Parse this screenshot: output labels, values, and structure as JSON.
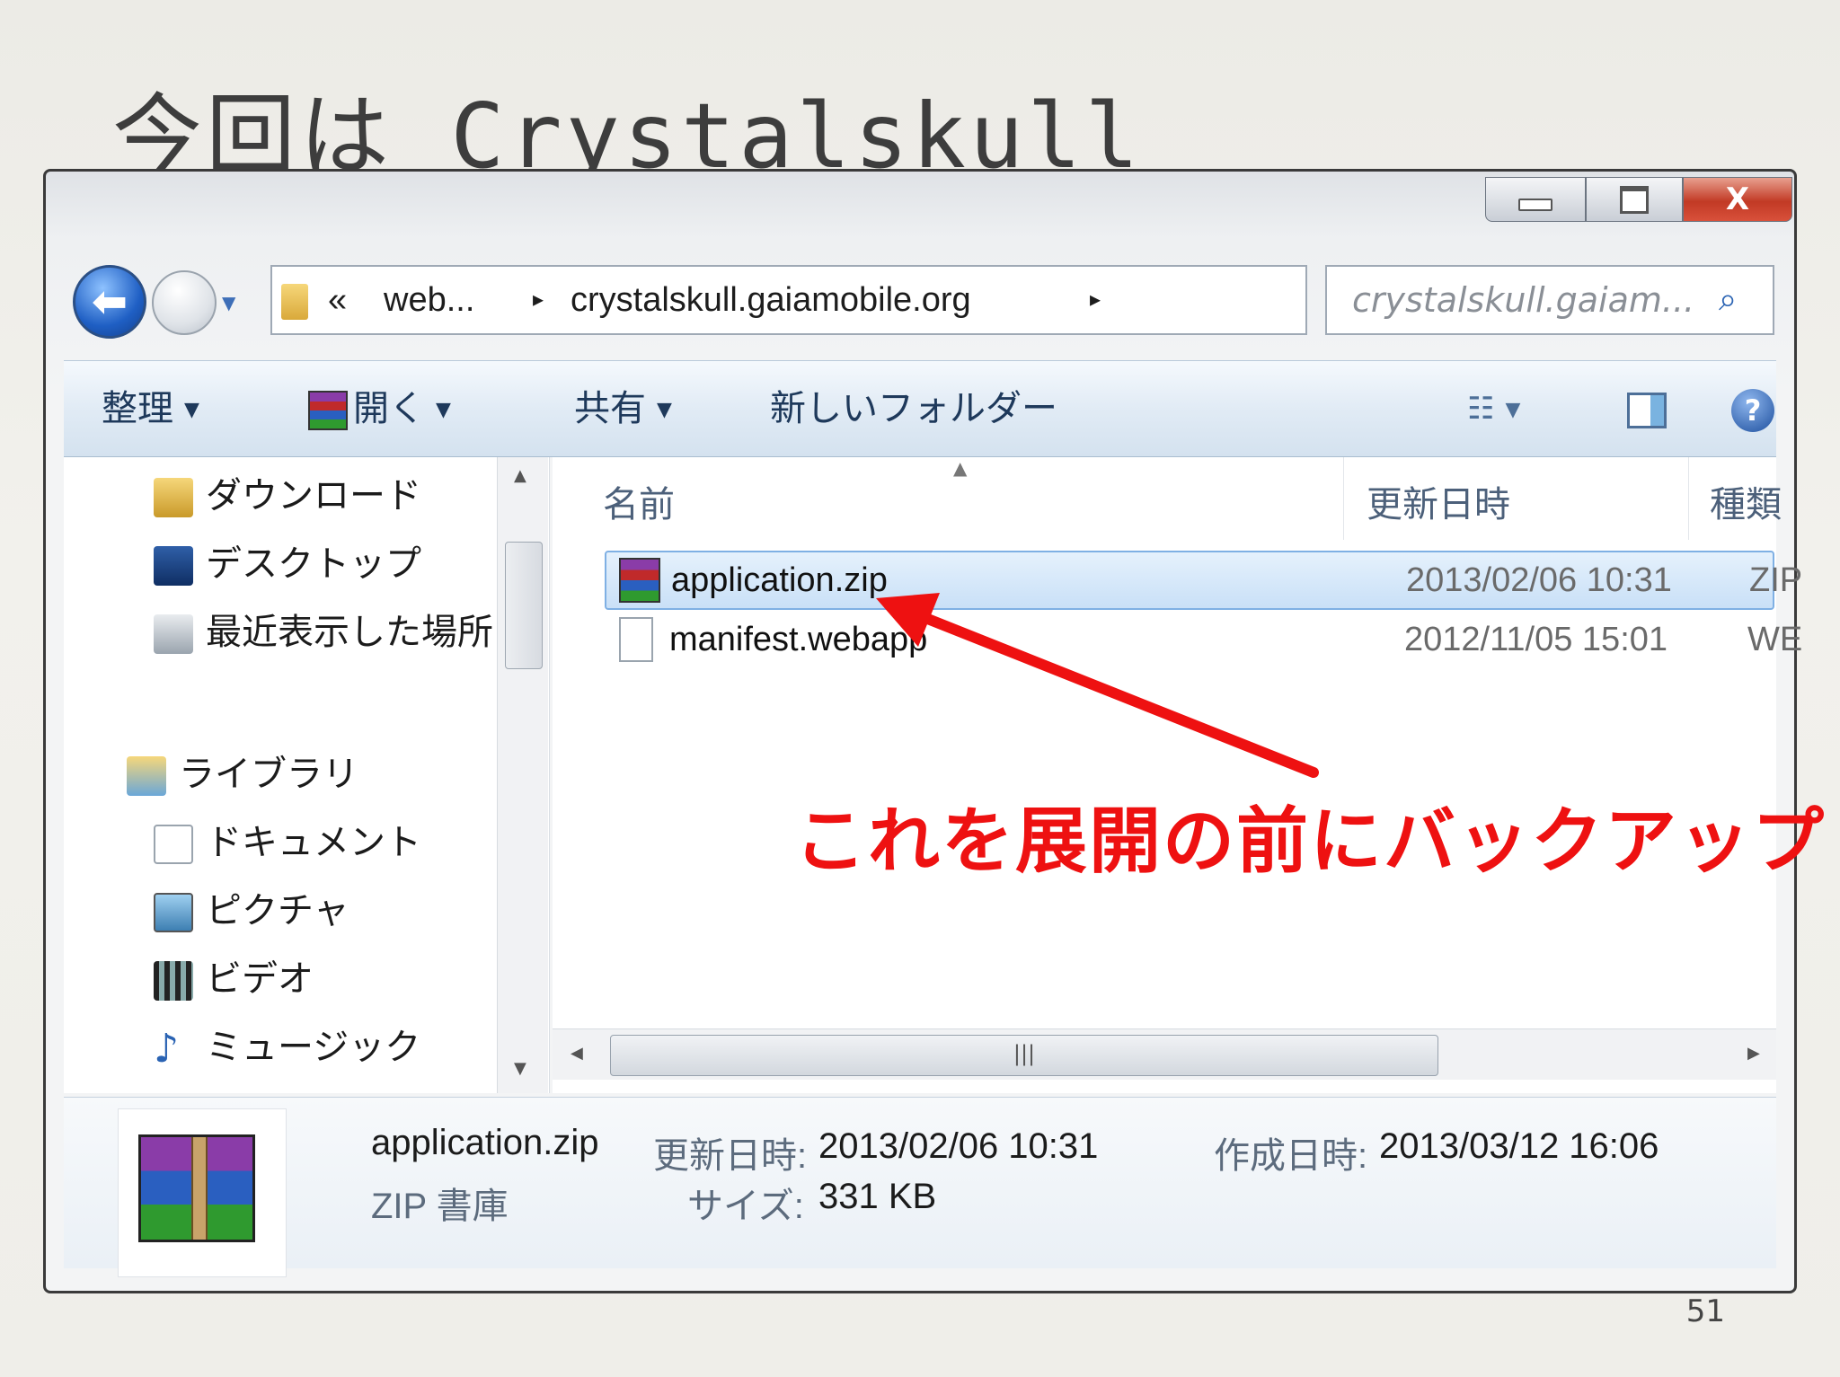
{
  "slide": {
    "title": "今回は Crystalskull",
    "page_number": "51"
  },
  "window": {
    "caption_buttons": {
      "minimize": "▭",
      "maximize": "▢",
      "close": "X"
    },
    "address": {
      "overflow": "«",
      "crumbs": [
        "web...",
        "crystalskull.gaiamobile.org"
      ],
      "separator": "▸"
    },
    "search": {
      "placeholder": "crystalskull.gaiam..."
    },
    "toolbar": {
      "organize": "整理",
      "open": "開く",
      "share": "共有",
      "new_folder": "新しいフォルダー"
    },
    "nav": {
      "items": [
        {
          "label": "ダウンロード",
          "icon": "download-folder-icon"
        },
        {
          "label": "デスクトップ",
          "icon": "desktop-icon"
        },
        {
          "label": "最近表示した場所",
          "icon": "recent-places-icon"
        },
        {
          "label": "ライブラリ",
          "icon": "library-icon"
        },
        {
          "label": "ドキュメント",
          "icon": "documents-icon"
        },
        {
          "label": "ピクチャ",
          "icon": "pictures-icon"
        },
        {
          "label": "ビデオ",
          "icon": "videos-icon"
        },
        {
          "label": "ミュージック",
          "icon": "music-icon"
        }
      ]
    },
    "columns": {
      "name": "名前",
      "modified": "更新日時",
      "type": "種類"
    },
    "files": [
      {
        "name": "application.zip",
        "modified": "2013/02/06 10:31",
        "type": "ZIP 書庫",
        "selected": true,
        "icon": "winrar-archive-icon"
      },
      {
        "name": "manifest.webapp",
        "modified": "2012/11/05 15:01",
        "type": "WEBAPP",
        "selected": false,
        "icon": "blank-file-icon"
      }
    ],
    "details": {
      "filename": "application.zip",
      "filetype": "ZIP 書庫",
      "modified_label": "更新日時:",
      "modified_value": "2013/02/06 10:31",
      "created_label": "作成日時:",
      "created_value": "2013/03/12 16:06",
      "size_label": "サイズ:",
      "size_value": "331 KB"
    }
  },
  "annotation": {
    "text": "これを展開の前にバックアップ",
    "color": "#ee1111"
  }
}
